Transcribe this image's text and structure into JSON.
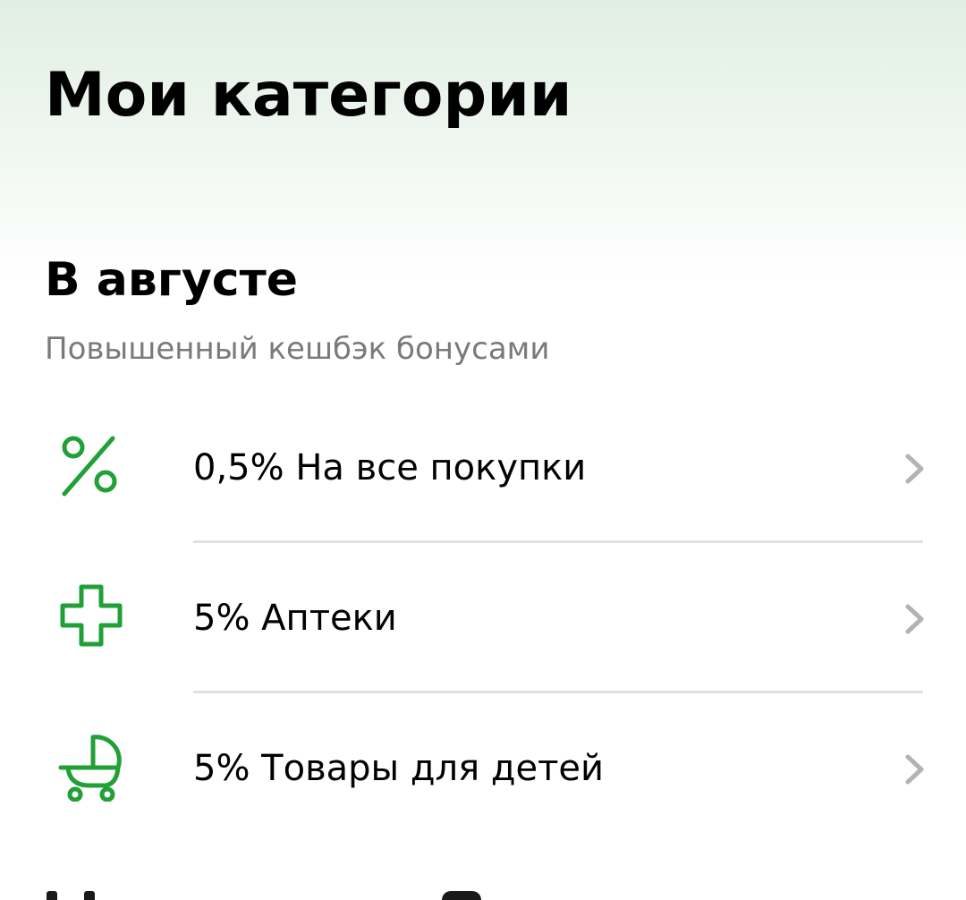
{
  "page": {
    "title": "Мои категории"
  },
  "section": {
    "title": "В августе",
    "subtitle": "Повышенный кешбэк бонусами"
  },
  "categories": [
    {
      "label": "0,5% На все покупки",
      "icon": "percent-icon"
    },
    {
      "label": "5% Аптеки",
      "icon": "medical-cross-icon"
    },
    {
      "label": "5% Товары для детей",
      "icon": "baby-stroller-icon"
    }
  ],
  "colors": {
    "accent": "#21a038",
    "chevron": "#b3b3b3",
    "divider": "#e0e0e0",
    "subtitle": "#7a7a7a"
  }
}
